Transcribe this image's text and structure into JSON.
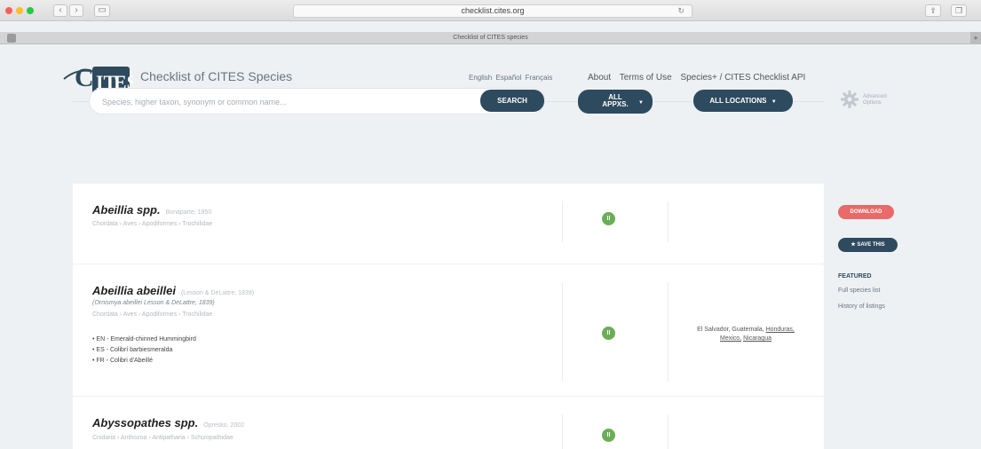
{
  "browser": {
    "url": "checklist.cites.org",
    "tab_title": "Checklist of CITES species"
  },
  "header": {
    "site_title": "Checklist of CITES Species",
    "languages": [
      "English",
      "Español",
      "Français"
    ],
    "nav": [
      "About",
      "Terms of Use",
      "Species+ / CITES Checklist API"
    ]
  },
  "search": {
    "placeholder": "Species, higher taxon, synonym or common name...",
    "search_label": "SEARCH",
    "apps_label_1": "ALL",
    "apps_label_2": "APPXS.",
    "locations_label": "ALL LOCATIONS",
    "advanced_1": "Advanced",
    "advanced_2": "Options"
  },
  "results": [
    {
      "name": "Abeillia spp.",
      "author": "Bonaparte, 1850",
      "taxonomy": "Chordata › Aves › Apodiformes › Trochilidae",
      "appendix": "II",
      "synonym": "",
      "common": [],
      "distribution": ""
    },
    {
      "name": "Abeillia abeillei",
      "author": "(Lesson & DeLattre, 1839)",
      "synonym": "(Ornismya abeillei Lesson & DeLattre, 1839)",
      "taxonomy": "Chordata › Aves › Apodiformes › Trochilidae",
      "common": [
        "EN - Emerald-chinned Hummingbird",
        "ES - Colibrí barbiesmeralda",
        "FR - Colibri d'Abeillé"
      ],
      "appendix": "II",
      "distribution_plain": "El Salvador, Guatemala, ",
      "distribution_links": [
        "Honduras,",
        "Mexico,",
        "Nicaragua"
      ]
    },
    {
      "name": "Abyssopathes spp.",
      "author": "Opresko, 2002",
      "taxonomy": "Cnidaria › Anthozoa › Antipatharia › Schizopathidae",
      "appendix": "II",
      "synonym": "",
      "common": [],
      "distribution": ""
    }
  ],
  "sidebar": {
    "download_label": "DOWNLOAD",
    "save_label": "SAVE THIS",
    "featured_title": "FEATURED",
    "featured_links": [
      "Full species list",
      "History of listings"
    ]
  },
  "colors": {
    "primary": "#2e4a5f",
    "appendix_badge": "#6cad58",
    "download": "#e86a6a",
    "background": "#eef1f4"
  },
  "icons": {
    "logo": "cites-logo",
    "gear": "gear-icon",
    "save": "star-icon"
  }
}
